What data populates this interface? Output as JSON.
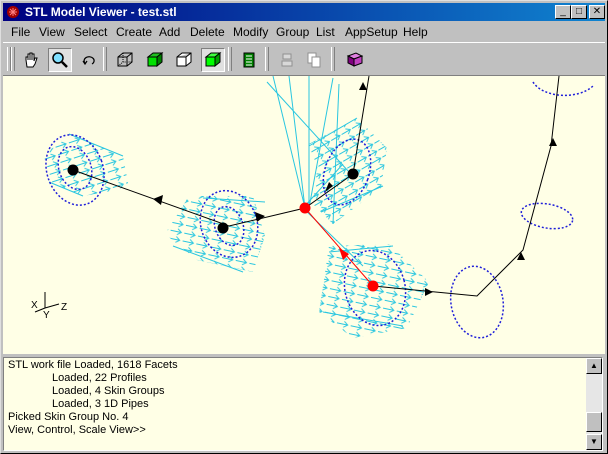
{
  "window": {
    "title": "STL Model Viewer - test.stl",
    "controls": {
      "minimize": "_",
      "maximize": "□",
      "close": "✕"
    }
  },
  "menu": [
    "File",
    "View",
    "Select",
    "Create",
    "Add",
    "Delete",
    "Modify",
    "Group",
    "List",
    "AppSetup",
    "Help"
  ],
  "toolbar": {
    "tools": [
      {
        "name": "pan-hand-icon",
        "state": "normal"
      },
      {
        "name": "zoom-magnifier-icon",
        "state": "pressed"
      },
      {
        "name": "rotate-icon",
        "state": "normal"
      },
      {
        "name": "wireframe-cube-icon",
        "state": "normal"
      },
      {
        "name": "shaded-cube-icon",
        "state": "normal"
      },
      {
        "name": "hidden-line-cube-icon",
        "state": "normal"
      },
      {
        "name": "solid-cube-icon",
        "state": "pressed"
      },
      {
        "name": "list-sheet-icon",
        "state": "normal"
      },
      {
        "name": "cut-icon",
        "state": "disabled"
      },
      {
        "name": "copy-icon",
        "state": "disabled"
      },
      {
        "name": "help-book-icon",
        "state": "normal"
      }
    ]
  },
  "viewport": {
    "axes": {
      "x": "X",
      "z": "Z",
      "y": "Y"
    },
    "colors": {
      "background": "#ffffe6",
      "profiles": "#1f1fd9",
      "skin": "#29c6e0",
      "path": "#000000",
      "selected": "#ff0000"
    }
  },
  "console": {
    "lines": [
      "STL work file Loaded, 1618 Facets",
      "Loaded, 22 Profiles",
      "Loaded, 4 Skin Groups",
      "Loaded, 3 1D Pipes",
      "Picked Skin Group No. 4",
      "View, Control, Scale View>>"
    ]
  },
  "scrollbar": {
    "up": "▲",
    "down": "▼"
  }
}
